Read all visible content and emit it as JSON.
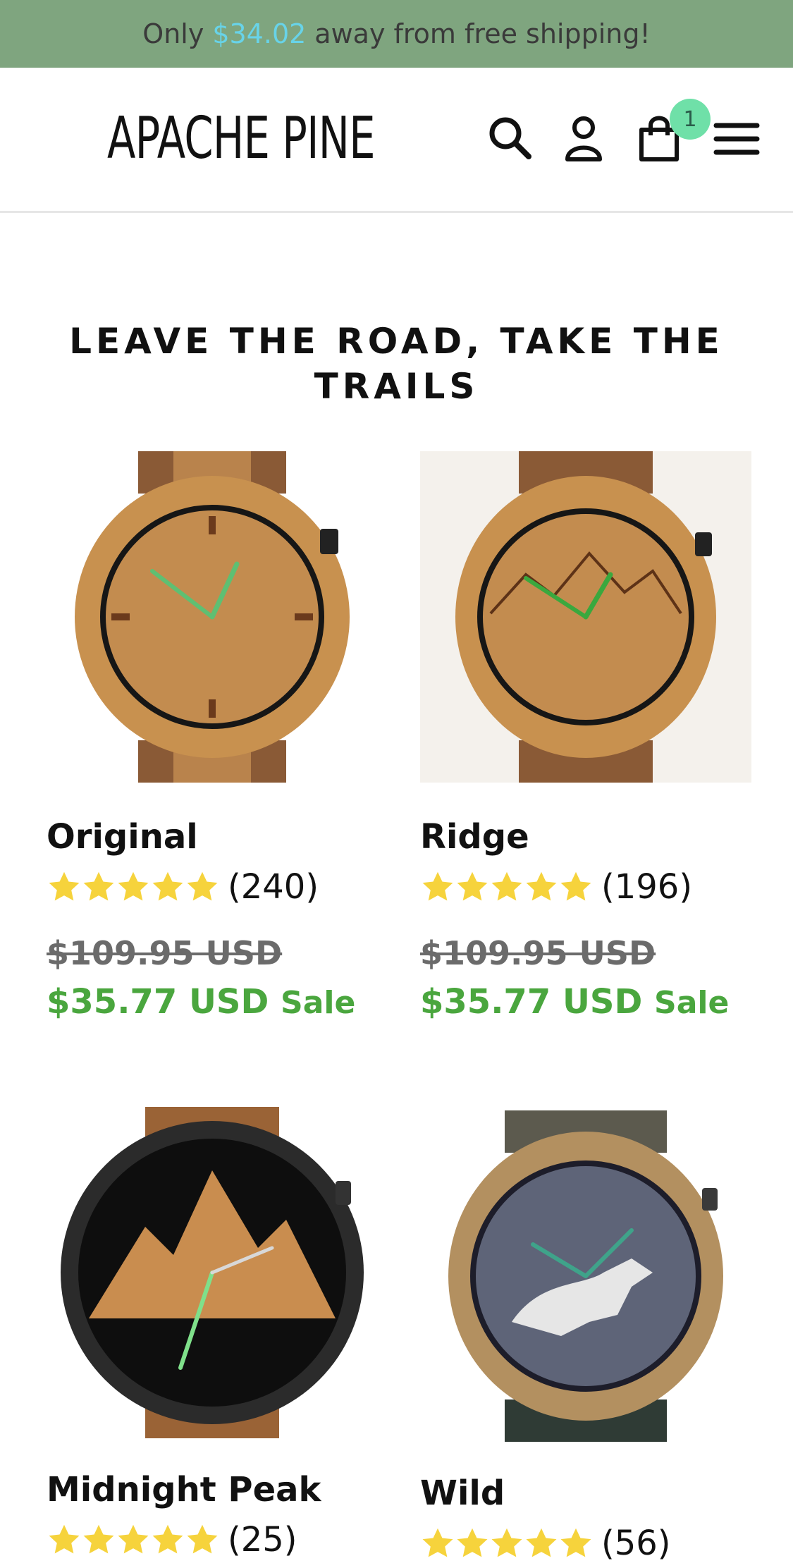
{
  "announcement": {
    "prefix": "Only",
    "amount": "$34.02",
    "suffix": "away from free shipping!"
  },
  "header": {
    "brand": "APACHE PINE",
    "cart_count": "1",
    "icons": [
      "search-icon",
      "account-icon",
      "cart-icon",
      "menu-icon"
    ]
  },
  "section": {
    "title": "LEAVE THE ROAD, TAKE THE TRAILS"
  },
  "products": [
    {
      "name": "Original",
      "rating": 5,
      "reviews": "(240)",
      "compare_price": "$109.95 USD",
      "sale_price": "$35.77 USD",
      "sale_tag": "Sale"
    },
    {
      "name": "Ridge",
      "rating": 5,
      "reviews": "(196)",
      "compare_price": "$109.95 USD",
      "sale_price": "$35.77 USD",
      "sale_tag": "Sale"
    },
    {
      "name": "Midnight Peak",
      "rating": 5,
      "reviews": "(25)"
    },
    {
      "name": "Wild",
      "rating": 5,
      "reviews": "(56)"
    }
  ],
  "colors": {
    "announcement_bg": "#7fa57f",
    "announcement_amount": "#68d3e8",
    "sale_price": "#4aa63e",
    "star": "#f6d33c",
    "cart_badge": "#6fe0a8"
  }
}
